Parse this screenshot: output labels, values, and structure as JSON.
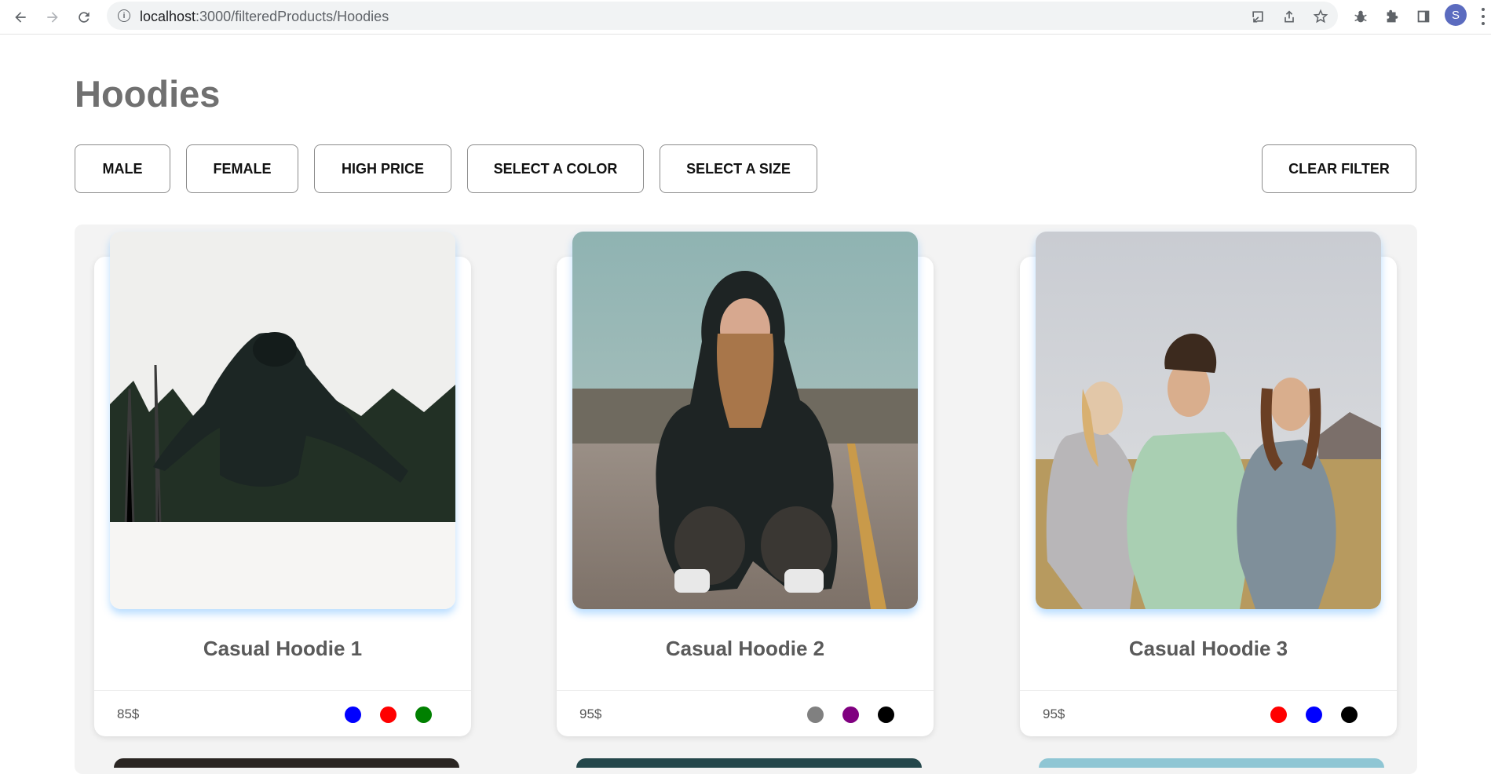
{
  "browser": {
    "url_host": "localhost",
    "url_path": ":3000/filteredProducts/Hoodies",
    "profile_initial": "S"
  },
  "page": {
    "title": "Hoodies"
  },
  "filters": {
    "male": "MALE",
    "female": "FEMALE",
    "high_price": "HIGH PRICE",
    "select_color": "SELECT A COLOR",
    "select_size": "SELECT A SIZE",
    "clear": "CLEAR FILTER"
  },
  "products": [
    {
      "name": "Casual Hoodie 1",
      "price": "85$",
      "colors": [
        "#0000ff",
        "#ff0000",
        "#008000"
      ]
    },
    {
      "name": "Casual Hoodie 2",
      "price": "95$",
      "colors": [
        "#808080",
        "#800080",
        "#000000"
      ]
    },
    {
      "name": "Casual Hoodie 3",
      "price": "95$",
      "colors": [
        "#ff0000",
        "#0000ff",
        "#000000"
      ]
    }
  ]
}
